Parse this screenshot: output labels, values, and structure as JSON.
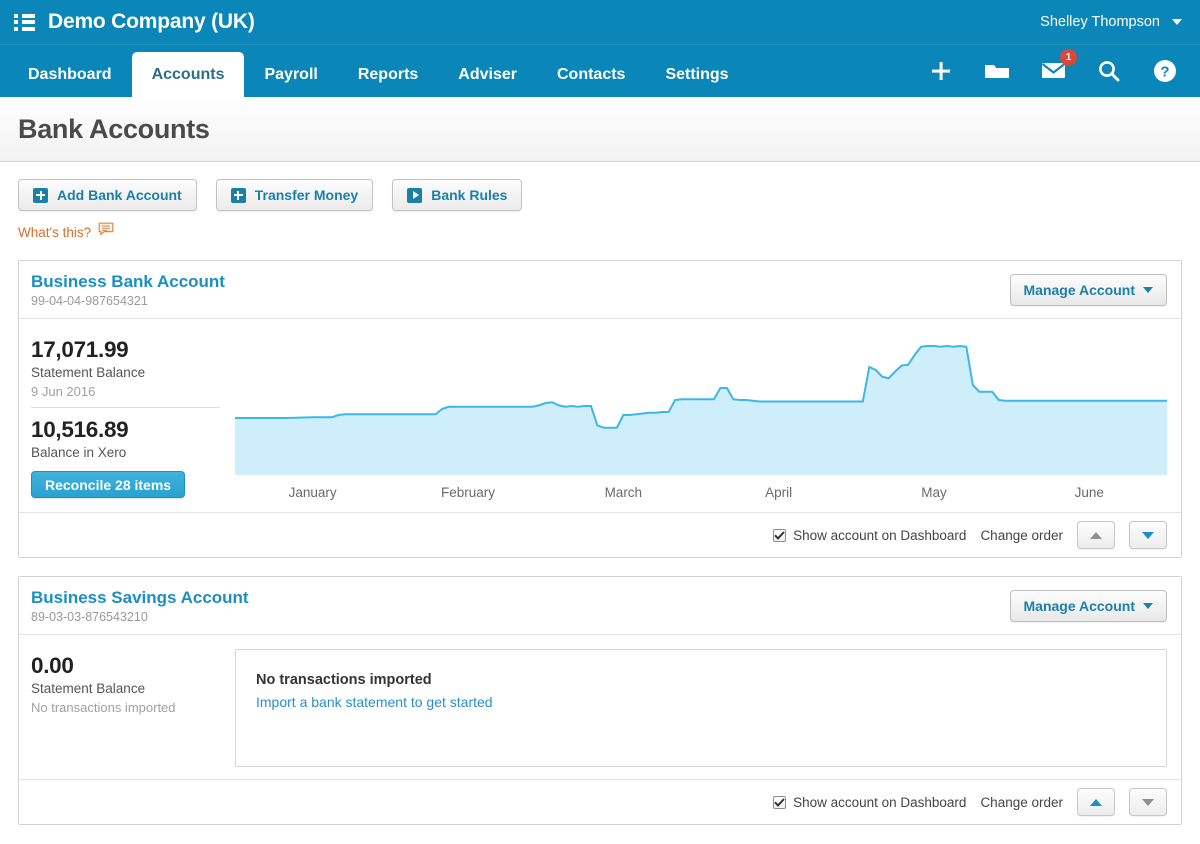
{
  "header": {
    "company": "Demo Company (UK)",
    "user": "Shelley Thompson",
    "menu_icon": "list-icon",
    "icons": [
      {
        "name": "plus-icon",
        "glyph": "+"
      },
      {
        "name": "folder-icon",
        "glyph": "folder"
      },
      {
        "name": "envelope-icon",
        "glyph": "envelope",
        "badge": "1"
      },
      {
        "name": "search-icon",
        "glyph": "magnifier"
      },
      {
        "name": "help-icon",
        "glyph": "question"
      }
    ]
  },
  "nav": {
    "tabs": [
      {
        "label": "Dashboard",
        "active": false
      },
      {
        "label": "Accounts",
        "active": true
      },
      {
        "label": "Payroll",
        "active": false
      },
      {
        "label": "Reports",
        "active": false
      },
      {
        "label": "Adviser",
        "active": false
      },
      {
        "label": "Contacts",
        "active": false
      },
      {
        "label": "Settings",
        "active": false
      }
    ]
  },
  "page": {
    "title": "Bank Accounts",
    "whats_this": "What's this?"
  },
  "toolbar": {
    "add_bank_account": "Add Bank Account",
    "transfer_money": "Transfer Money",
    "bank_rules": "Bank Rules"
  },
  "common": {
    "manage_account": "Manage Account",
    "show_on_dashboard": "Show account on Dashboard",
    "change_order": "Change order"
  },
  "accounts": [
    {
      "name": "Business Bank Account",
      "number": "99-04-04-987654321",
      "statement_balance": "17,071.99",
      "statement_balance_label": "Statement Balance",
      "statement_date": "9 Jun 2016",
      "xero_balance": "10,516.89",
      "xero_balance_label": "Balance in Xero",
      "reconcile_label": "Reconcile 28 items",
      "show_on_dashboard_checked": true,
      "up_enabled": false,
      "down_enabled": true
    },
    {
      "name": "Business Savings Account",
      "number": "89-03-03-876543210",
      "statement_balance": "0.00",
      "statement_balance_label": "Statement Balance",
      "statement_date": "No transactions imported",
      "empty_title": "No transactions imported",
      "empty_link": "Import a bank statement to get started",
      "show_on_dashboard_checked": true,
      "up_enabled": true,
      "down_enabled": false
    }
  ],
  "colors": {
    "brand_blue": "#0b86b8",
    "link_blue": "#1b8fc4",
    "chart_line": "#3fb6e8",
    "chart_fill": "#cdeefa",
    "orange": "#d96d2b",
    "badge_red": "#d9483b"
  },
  "chart_data": {
    "type": "area",
    "title": "",
    "xlabel": "",
    "ylabel": "",
    "categories": [
      "January",
      "February",
      "March",
      "April",
      "May",
      "June"
    ],
    "series": [
      {
        "name": "Statement Balance",
        "points": [
          [
            0,
            0.38
          ],
          [
            4,
            0.38
          ],
          [
            8,
            0.38
          ],
          [
            12,
            0.385
          ],
          [
            15,
            0.385
          ],
          [
            16,
            0.4
          ],
          [
            17,
            0.405
          ],
          [
            21,
            0.405
          ],
          [
            26,
            0.405
          ],
          [
            31,
            0.405
          ],
          [
            32,
            0.44
          ],
          [
            33,
            0.455
          ],
          [
            36,
            0.455
          ],
          [
            41,
            0.455
          ],
          [
            46,
            0.455
          ],
          [
            47,
            0.465
          ],
          [
            48,
            0.48
          ],
          [
            49,
            0.485
          ],
          [
            50,
            0.465
          ],
          [
            51,
            0.455
          ],
          [
            52,
            0.46
          ],
          [
            53,
            0.455
          ],
          [
            54,
            0.46
          ],
          [
            55,
            0.46
          ],
          [
            56,
            0.33
          ],
          [
            57,
            0.315
          ],
          [
            58,
            0.315
          ],
          [
            59,
            0.315
          ],
          [
            60,
            0.4
          ],
          [
            61,
            0.4
          ],
          [
            62,
            0.405
          ],
          [
            63,
            0.41
          ],
          [
            64,
            0.415
          ],
          [
            65,
            0.415
          ],
          [
            66,
            0.42
          ],
          [
            67,
            0.42
          ],
          [
            68,
            0.5
          ],
          [
            69,
            0.505
          ],
          [
            70,
            0.505
          ],
          [
            71,
            0.505
          ],
          [
            72,
            0.505
          ],
          [
            73,
            0.505
          ],
          [
            74,
            0.505
          ],
          [
            75,
            0.58
          ],
          [
            76,
            0.58
          ],
          [
            77,
            0.505
          ],
          [
            78,
            0.5
          ],
          [
            79,
            0.5
          ],
          [
            80,
            0.495
          ],
          [
            81,
            0.49
          ],
          [
            82,
            0.49
          ],
          [
            83,
            0.49
          ],
          [
            84,
            0.49
          ],
          [
            88,
            0.49
          ],
          [
            92,
            0.49
          ],
          [
            96,
            0.49
          ],
          [
            97,
            0.49
          ],
          [
            98,
            0.72
          ],
          [
            99,
            0.7
          ],
          [
            100,
            0.655
          ],
          [
            101,
            0.645
          ],
          [
            102,
            0.69
          ],
          [
            103,
            0.73
          ],
          [
            104,
            0.735
          ],
          [
            105,
            0.8
          ],
          [
            106,
            0.855
          ],
          [
            107,
            0.86
          ],
          [
            108,
            0.86
          ],
          [
            109,
            0.855
          ],
          [
            110,
            0.86
          ],
          [
            111,
            0.855
          ],
          [
            112,
            0.86
          ],
          [
            113,
            0.855
          ],
          [
            114,
            0.6
          ],
          [
            115,
            0.555
          ],
          [
            116,
            0.555
          ],
          [
            117,
            0.555
          ],
          [
            118,
            0.5
          ],
          [
            119,
            0.495
          ],
          [
            120,
            0.495
          ],
          [
            124,
            0.495
          ],
          [
            128,
            0.495
          ],
          [
            132,
            0.495
          ],
          [
            136,
            0.495
          ],
          [
            140,
            0.495
          ],
          [
            144,
            0.495
          ]
        ]
      }
    ],
    "xlim": [
      0,
      144
    ],
    "ylim": [
      0,
      1
    ],
    "grid": false,
    "legend": "none"
  }
}
